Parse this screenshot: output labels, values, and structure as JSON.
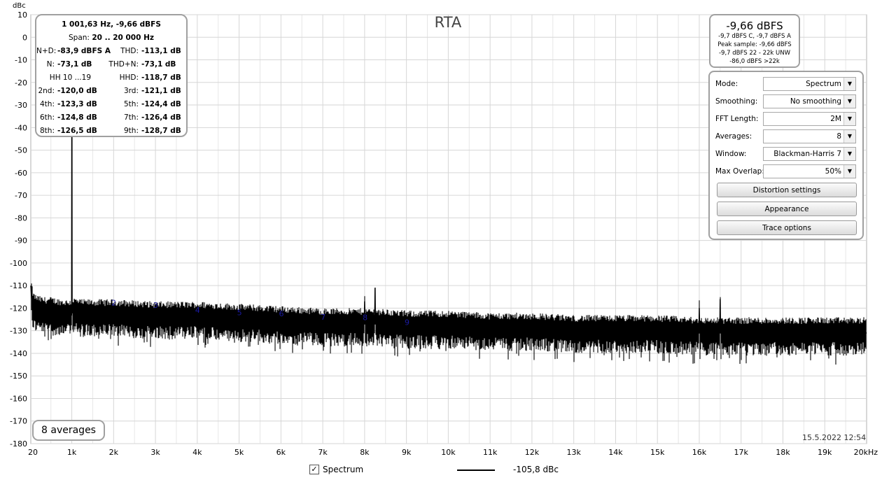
{
  "axis": {
    "y_unit": "dBc",
    "y_ticks": [
      "10",
      "0",
      "-10",
      "-20",
      "-30",
      "-40",
      "-50",
      "-60",
      "-70",
      "-80",
      "-90",
      "-100",
      "-110",
      "-120",
      "-130",
      "-140",
      "-150",
      "-160",
      "-170",
      "-180"
    ],
    "x_ticks": [
      "20",
      "1k",
      "2k",
      "3k",
      "4k",
      "5k",
      "6k",
      "7k",
      "8k",
      "9k",
      "10k",
      "11k",
      "12k",
      "13k",
      "14k",
      "15k",
      "16k",
      "17k",
      "18k",
      "19k",
      "20kHz"
    ]
  },
  "title": "RTA",
  "info": {
    "line1": "1 001,63 Hz, -9,66 dBFS",
    "span_label": "Span:",
    "span_value": "20 .. 20 000 Hz",
    "nd_label": "N+D:",
    "nd_value": "-83,9 dBFS A",
    "thd_label": "THD:",
    "thd_value": "-113,1 dB",
    "n_label": "N:",
    "n_value": "-73,1 dB",
    "thdn_label": "THD+N:",
    "thdn_value": "-73,1 dB",
    "hh_label": "HH 10 ...19",
    "hhd_label": "HHD:",
    "hhd_value": "-118,7 dB",
    "h2_label": "2nd:",
    "h2_value": "-120,0 dB",
    "h3_label": "3rd:",
    "h3_value": "-121,1 dB",
    "h4_label": "4th:",
    "h4_value": "-123,3 dB",
    "h5_label": "5th:",
    "h5_value": "-124,4 dB",
    "h6_label": "6th:",
    "h6_value": "-124,8 dB",
    "h7_label": "7th:",
    "h7_value": "-126,4 dB",
    "h8_label": "8th:",
    "h8_value": "-126,5 dB",
    "h9_label": "9th:",
    "h9_value": "-128,7 dB"
  },
  "level": {
    "main": "-9,66 dBFS",
    "line1": "-9,7 dBFS C, -9,7 dBFS A",
    "line2": "Peak sample: -9,66 dBFS",
    "line3": "-9,7 dBFS 22 - 22k UNW",
    "line4": "-86,0 dBFS >22k"
  },
  "controls": {
    "mode_label": "Mode:",
    "mode_value": "Spectrum",
    "smoothing_label": "Smoothing:",
    "smoothing_value": "No  smoothing",
    "fft_label": "FFT Length:",
    "fft_value": "2M",
    "averages_label": "Averages:",
    "averages_value": "8",
    "window_label": "Window:",
    "window_value": "Blackman-Harris 7",
    "overlap_label": "Max Overlap:",
    "overlap_value": "50%",
    "distortion_button": "Distortion settings",
    "appearance_button": "Appearance",
    "trace_button": "Trace options"
  },
  "averages_badge": "8 averages",
  "timestamp": "15.5.2022 12:54",
  "legend": {
    "trace_name": "Spectrum",
    "checked": true,
    "cursor_value": "-105,8 dBc"
  },
  "colors": {
    "trace": "#000000",
    "harmonic_marker": "#1a1aa0",
    "grid": "#d6d6d6",
    "panel_border": "#a0a0a0"
  },
  "chart_data": {
    "type": "line",
    "x_unit": "Hz",
    "y_unit": "dBc",
    "xlim": [
      20,
      20000
    ],
    "ylim": [
      -180,
      10
    ],
    "grid": true,
    "series": [
      {
        "name": "Spectrum",
        "x": [
          20,
          40,
          80,
          150,
          300,
          500,
          800,
          995,
          1001.63,
          1008,
          1200,
          1500,
          2000,
          3000,
          4000,
          5000,
          6000,
          7000,
          7990,
          8000,
          8010,
          8240,
          8250,
          8260,
          9000,
          10000,
          11000,
          12000,
          13000,
          14000,
          15000,
          15990,
          16000,
          16010,
          16490,
          16500,
          16510,
          17000,
          18000,
          19000,
          20000
        ],
        "y": [
          -110,
          -116,
          -120,
          -121,
          -122,
          -122,
          -123,
          -123,
          0,
          -122,
          -123,
          -123,
          -123,
          -124,
          -124,
          -125,
          -126,
          -127,
          -127,
          -117,
          -127,
          -127,
          -111,
          -127,
          -128,
          -128,
          -129,
          -129,
          -130,
          -130,
          -130,
          -131,
          -120,
          -131,
          -131,
          -116,
          -131,
          -131,
          -131,
          -131,
          -131
        ]
      }
    ],
    "harmonic_markers": [
      {
        "label": "2",
        "x": 2003,
        "y": -120.0
      },
      {
        "label": "3",
        "x": 3005,
        "y": -121.1
      },
      {
        "label": "4",
        "x": 4007,
        "y": -123.3
      },
      {
        "label": "5",
        "x": 5008,
        "y": -124.4
      },
      {
        "label": "6",
        "x": 6010,
        "y": -124.8
      },
      {
        "label": "7",
        "x": 7011,
        "y": -126.4
      },
      {
        "label": "8",
        "x": 8013,
        "y": -126.5
      },
      {
        "label": "9",
        "x": 9015,
        "y": -128.7
      }
    ]
  }
}
